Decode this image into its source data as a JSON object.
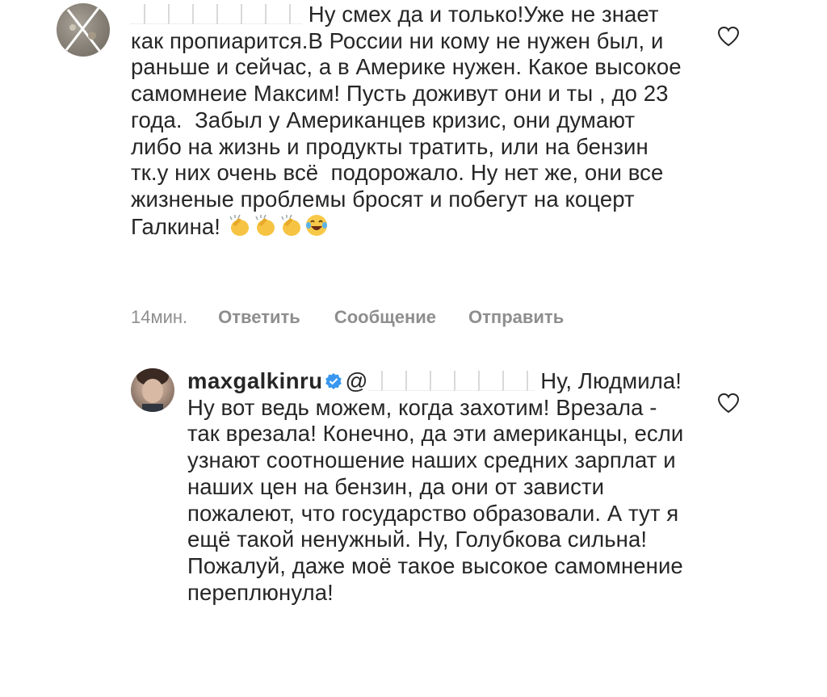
{
  "comments": [
    {
      "username_redacted": true,
      "text_after_username": " Ну смех да и только!Уже не знает как пропиарится.В России ни кому не нужен был, и раньше и сейчас, а в Америке нужен. Какое высокое самомнеие Максим! Пусть доживут они и ты , до 23 года.  Забыл у Американцев кризис, они думают либо на жизнь и продукты тратить, или на бензин тк.у них очень всё  подорожало. Ну нет же, они все жизненые проблемы бросят и побегут на коцерт Галкина! ",
      "emoji": [
        "clapping-hands",
        "clapping-hands",
        "clapping-hands",
        "tears-of-joy"
      ],
      "time": "14мин.",
      "actions": {
        "reply": "Ответить",
        "message": "Сообщение",
        "send": "Отправить"
      }
    },
    {
      "username": "maxgalkinru",
      "verified": true,
      "mention_prefix": "@",
      "text_after_mention": " Ну, Людмила! Ну вот ведь можем, когда захотим! Врезала - так врезала! Конечно, да эти американцы, если узнают соотношение наших средних зарплат и наших цен на бензин, да они от зависти пожалеют, что государство образовали. А тут я ещё такой ненужный. Ну, Голубкова сильна! Пожалуй, даже моё такое высокое самомнение переплюнула!"
    }
  ],
  "colors": {
    "text": "#262626",
    "meta": "#8e8e8e",
    "verified": "#3897f0"
  }
}
